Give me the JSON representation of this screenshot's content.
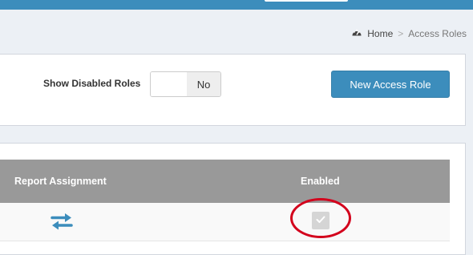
{
  "breadcrumb": {
    "home_label": "Home",
    "separator": ">",
    "current": "Access Roles",
    "icon": "dashboard-gauge-icon"
  },
  "filters": {
    "show_disabled_label": "Show Disabled Roles",
    "toggle_value": "No"
  },
  "actions": {
    "new_role_label": "New Access Role"
  },
  "table": {
    "columns": [
      "Report Assignment",
      "Enabled"
    ],
    "rows": [
      {
        "report_assignment_icon": "swap-arrows-icon",
        "enabled": true
      }
    ]
  },
  "colors": {
    "accent": "#3c8dbc",
    "header_bg": "#999999",
    "highlight": "#d3001c"
  }
}
